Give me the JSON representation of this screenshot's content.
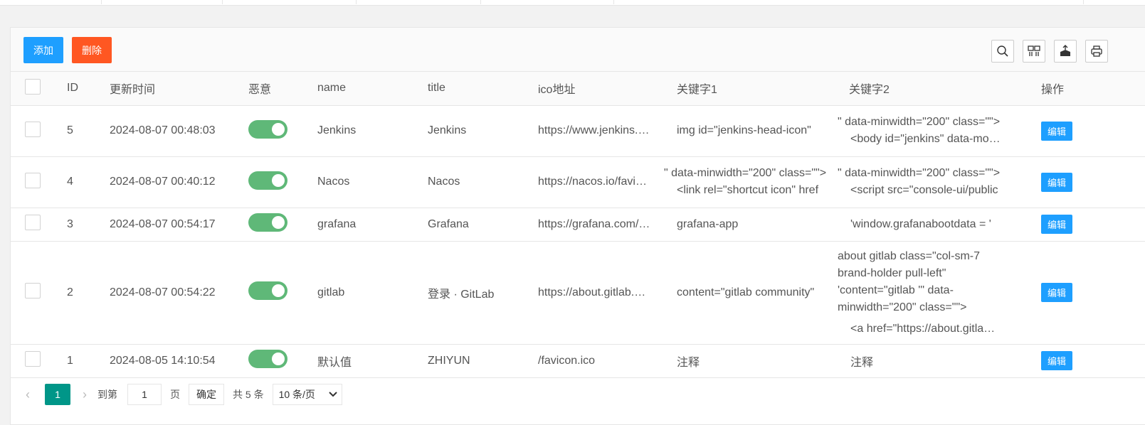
{
  "toolbar": {
    "add_label": "添加",
    "delete_label": "删除",
    "tools": [
      "search-icon",
      "columns-icon",
      "export-icon",
      "print-icon"
    ]
  },
  "table": {
    "headers": [
      "ID",
      "更新时间",
      "恶意",
      "name",
      "title",
      "ico地址",
      "关键字1",
      "关键字2",
      "操作"
    ],
    "rows": [
      {
        "id": "5",
        "time": "2024-08-07 00:48:03",
        "malicious": true,
        "name": "Jenkins",
        "title": "Jenkins",
        "ico": "https://www.jenkins.io/favicon.ico",
        "kw1_line1": "",
        "kw1_line2": "img id=\"jenkins-head-icon\"",
        "kw2_line1": "\" data-minwidth=\"200\" class=\"\">",
        "kw2_line2": "<body id=\"jenkins\" data-model-type",
        "action": "编辑"
      },
      {
        "id": "4",
        "time": "2024-08-07 00:40:12",
        "malicious": true,
        "name": "Nacos",
        "title": "Nacos",
        "ico": "https://nacos.io/favicon.ico",
        "kw1_line1": "\" data-minwidth=\"200\" class=\"\">",
        "kw1_line2": "<link rel=\"shortcut icon\" href",
        "kw2_line1": "\" data-minwidth=\"200\" class=\"\">",
        "kw2_line2": "<script src=\"console-ui/public",
        "action": "编辑"
      },
      {
        "id": "3",
        "time": "2024-08-07 00:54:17",
        "malicious": true,
        "name": "grafana",
        "title": "Grafana",
        "ico": "https://grafana.com/favicon.ico",
        "kw1_line1": "",
        "kw1_line2": "grafana-app",
        "kw2_line1": "",
        "kw2_line2": "'window.grafanabootdata = '",
        "action": "编辑"
      },
      {
        "id": "2",
        "time": "2024-08-07 00:54:22",
        "malicious": true,
        "name": "gitlab",
        "title": "登录 · GitLab",
        "ico": "https://about.gitlab.com/favicon.ico",
        "kw1_line1": "",
        "kw1_line2": "content=\"gitlab community\"",
        "kw2_wrap": "about gitlab class=\"col-sm-7 brand-holder pull-left\" 'content=\"gitlab '\" data-minwidth=\"200\" class=\"\">",
        "kw2_line2": "<a href=\"https://about.gitlab.com/\"",
        "action": "编辑"
      },
      {
        "id": "1",
        "time": "2024-08-05 14:10:54",
        "malicious": true,
        "name": "默认值",
        "title": "ZHIYUN",
        "ico": "/favicon.ico",
        "kw1_line1": "",
        "kw1_line2": "注释",
        "kw2_line1": "",
        "kw2_line2": "注释",
        "action": "编辑"
      }
    ]
  },
  "pager": {
    "prev": "‹",
    "current": "1",
    "next": "›",
    "goto_label": "到第",
    "goto_value": "1",
    "page_unit": "页",
    "confirm_label": "确定",
    "total_label": "共 5 条",
    "per_page": "10 条/页"
  },
  "colors": {
    "primary": "#1e9fff",
    "danger": "#ff5722",
    "switch_on": "#5fb878",
    "page_active": "#009688"
  }
}
